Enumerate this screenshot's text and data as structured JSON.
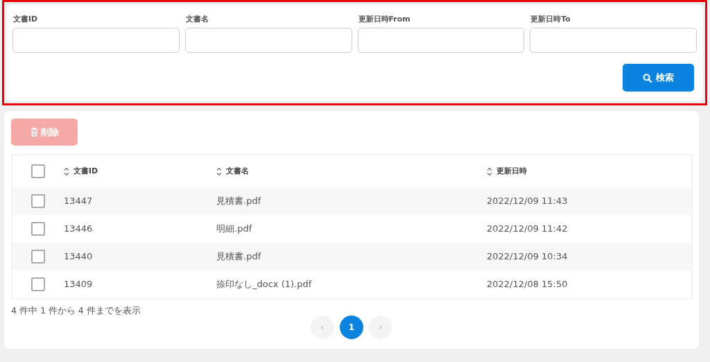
{
  "search_form": {
    "fields": [
      {
        "label": "文書ID"
      },
      {
        "label": "文書名"
      },
      {
        "label": "更新日時From"
      },
      {
        "label": "更新日時To"
      }
    ],
    "search_button": {
      "label": "検索"
    }
  },
  "delete_button": {
    "label": "削除",
    "disabled": true
  },
  "table": {
    "select_all": {
      "checked": false
    },
    "columns": [
      "文書ID",
      "文書名",
      "更新日時"
    ],
    "rows": [
      {
        "checked": false,
        "cells": [
          "13447",
          "見積書.pdf",
          "2022/12/09 11:43"
        ]
      },
      {
        "checked": false,
        "cells": [
          "13446",
          "明細.pdf",
          "2022/12/09 11:42"
        ]
      },
      {
        "checked": false,
        "cells": [
          "13440",
          "見積書.pdf",
          "2022/12/09 10:34"
        ]
      },
      {
        "checked": false,
        "cells": [
          "13409",
          "捺印なし_docx (1).pdf",
          "2022/12/08 15:50"
        ]
      }
    ]
  },
  "summary": "4 件中 1 件から 4 件までを表示",
  "pagination": {
    "prev": {
      "label": "‹",
      "disabled": true
    },
    "pages": [
      {
        "label": "1",
        "selected": true
      }
    ],
    "next": {
      "label": "›",
      "disabled": true
    }
  }
}
